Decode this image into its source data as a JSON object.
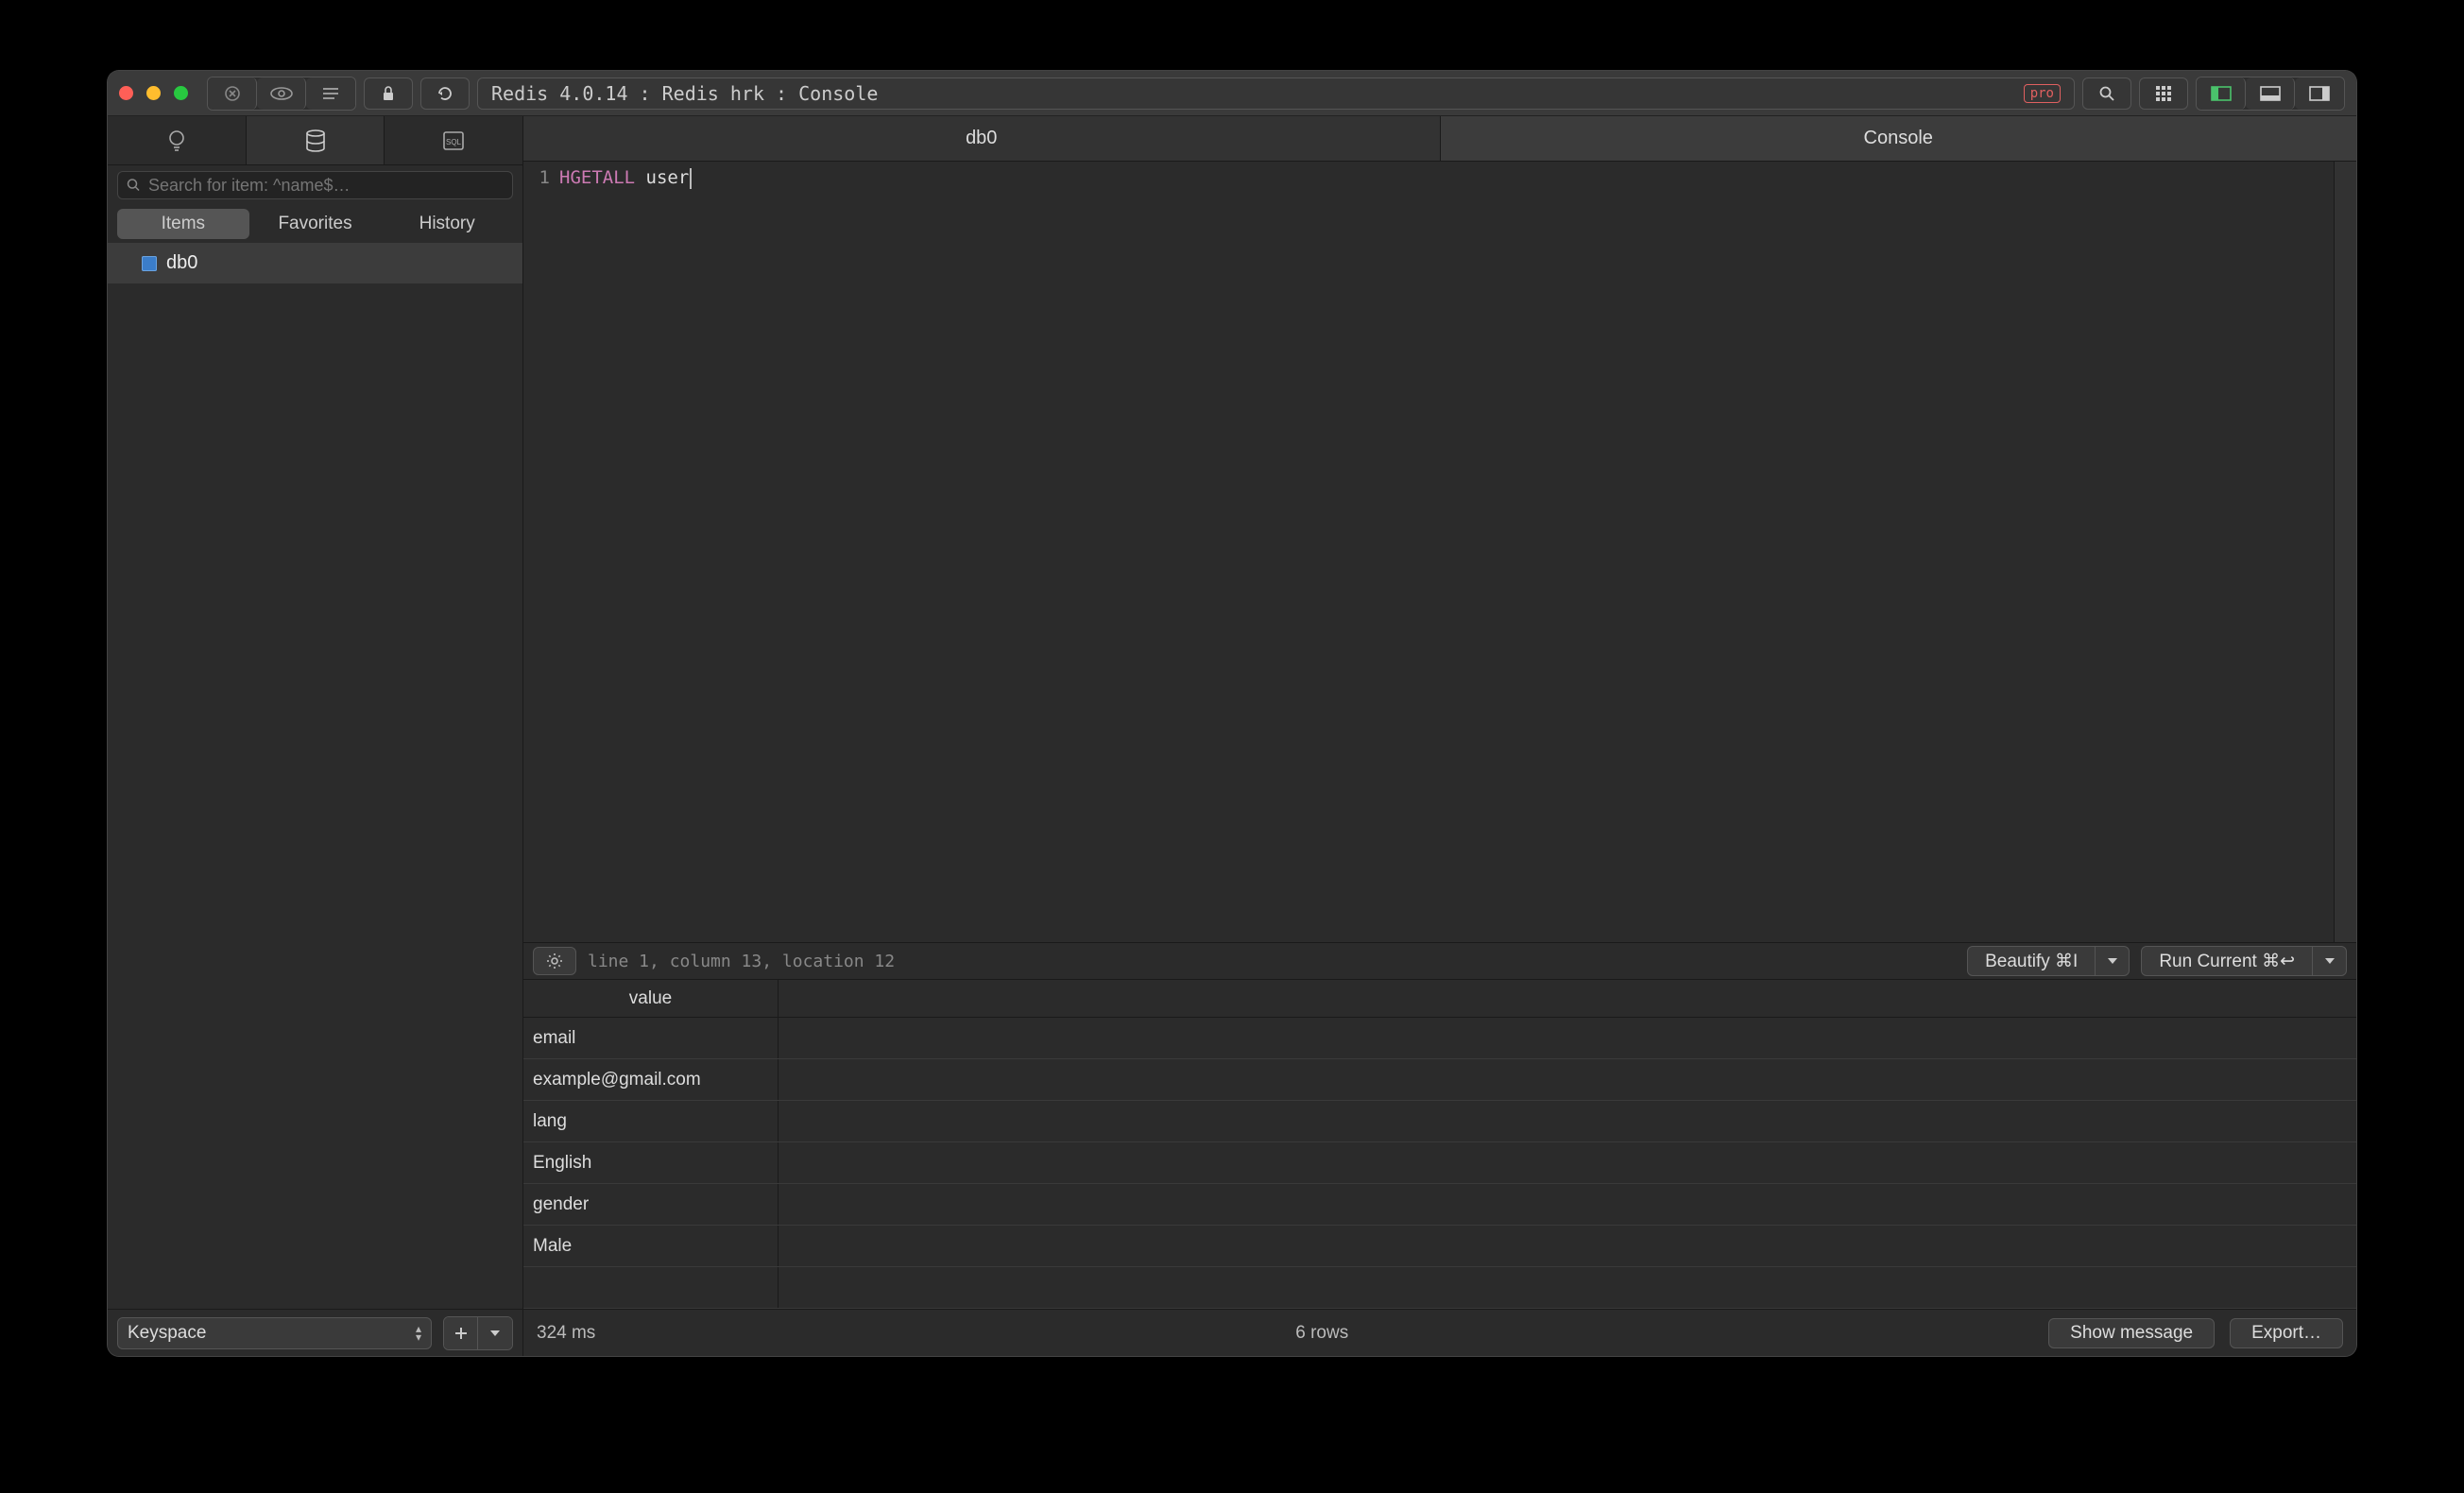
{
  "titlebar": {
    "title": "Redis 4.0.14 : Redis hrk : Console",
    "pro_label": "pro"
  },
  "sidebar": {
    "search_placeholder": "Search for item: ^name$…",
    "filter_tabs": [
      "Items",
      "Favorites",
      "History"
    ],
    "items": [
      {
        "label": "db0"
      }
    ],
    "bottom_select": "Keyspace"
  },
  "tabs": [
    "db0",
    "Console"
  ],
  "editor": {
    "line_number": "1",
    "keyword": "HGETALL",
    "rest": " user",
    "status": "line 1, column 13, location 12",
    "beautify_label": "Beautify ⌘I",
    "run_label": "Run Current ⌘↩"
  },
  "results": {
    "column_header": "value",
    "rows": [
      "email",
      "example@gmail.com",
      "lang",
      "English",
      "gender",
      "Male"
    ]
  },
  "bottom": {
    "time": "324 ms",
    "rows": "6 rows",
    "show_msg": "Show message",
    "export": "Export…"
  }
}
